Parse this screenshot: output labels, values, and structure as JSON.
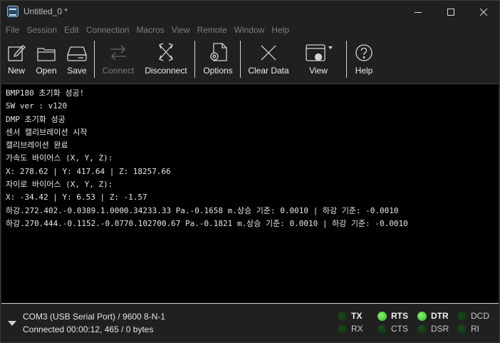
{
  "window": {
    "title": "Untitled_0 *"
  },
  "menu": [
    "File",
    "Session",
    "Edit",
    "Connection",
    "Macros",
    "View",
    "Remote",
    "Window",
    "Help"
  ],
  "toolbar": {
    "new": "New",
    "open": "Open",
    "save": "Save",
    "connect": "Connect",
    "disconnect": "Disconnect",
    "options": "Options",
    "clear_data": "Clear Data",
    "view": "View",
    "help": "Help"
  },
  "terminal": {
    "lines": [
      "BMP180 초기화 성공!",
      "SW ver : v120",
      "DMP 초기화 성공",
      "센서 캘리브레이션 시작",
      "캘리브레이션 완료",
      "가속도 바이어스 (X, Y, Z):",
      "X: 278.62 | Y: 417.64 | Z: 18257.66",
      "자이로 바이어스 (X, Y, Z):",
      "X: -34.42 | Y: 6.53 | Z: -1.57",
      "하강.272.402.-0.0389.1.0000.34233.33 Pa.-0.1658 m.상승 기준: 0.0010 | 하강 기준: -0.0010",
      "하강.270.444.-0.1152.-0.0770.102700.67 Pa.-0.1821 m.상승 기준: 0.0010 | 하강 기준: -0.0010"
    ]
  },
  "status": {
    "port": "COM3 (USB Serial Port) / 9600 8-N-1",
    "connection": "Connected 00:00:12, 465 / 0 bytes",
    "signals": {
      "tx": "TX",
      "rx": "RX",
      "rts": "RTS",
      "cts": "CTS",
      "dtr": "DTR",
      "dsr": "DSR",
      "dcd": "DCD",
      "ri": "RI"
    },
    "signal_states": {
      "tx": false,
      "rx": false,
      "rts": true,
      "cts": false,
      "dtr": true,
      "dsr": false,
      "dcd": false,
      "ri": false
    }
  },
  "colors": {
    "led_on": "#3ecf3e",
    "led_off": "#153a15",
    "terminal_bg": "#000000"
  }
}
